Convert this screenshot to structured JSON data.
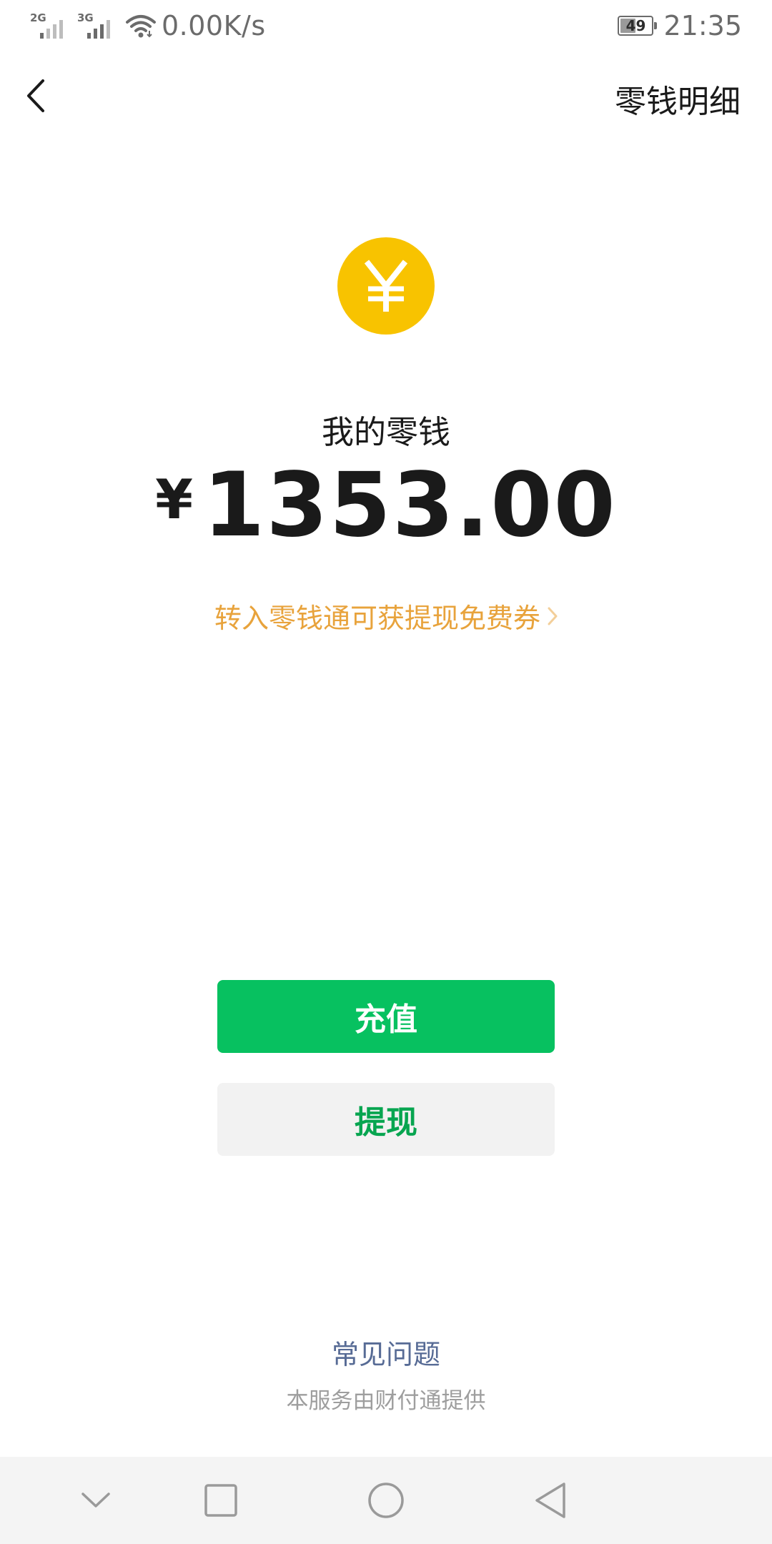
{
  "status_bar": {
    "sim1_network": "2G",
    "sim2_network": "3G",
    "net_speed": "0.00K/s",
    "battery_level": "49",
    "battery_fraction": 0.49,
    "time": "21:35",
    "icons": [
      "signal-icon",
      "signal-icon",
      "wifi-icon",
      "battery-icon"
    ]
  },
  "nav": {
    "back_icon": "chevron-left-icon",
    "detail_link": "零钱明细"
  },
  "balance": {
    "coin_icon": "yuan-coin-icon",
    "label": "我的零钱",
    "currency": "¥",
    "amount": "1353.00",
    "promo_text": "转入零钱通可获提现免费券",
    "promo_icon": "chevron-right-icon"
  },
  "actions": {
    "topup_label": "充值",
    "withdraw_label": "提现"
  },
  "footer": {
    "faq_label": "常见问题",
    "provider_text": "本服务由财付通提供"
  },
  "system_nav": {
    "icons": [
      "chevron-down-icon",
      "recent-apps-icon",
      "home-icon",
      "back-triangle-icon"
    ]
  },
  "colors": {
    "coin": "#f8c300",
    "primary_green": "#07c160",
    "withdraw_text": "#07a550",
    "promo_orange": "#e8a33c",
    "link_blue": "#576b95",
    "muted_gray": "#9e9e9e"
  }
}
